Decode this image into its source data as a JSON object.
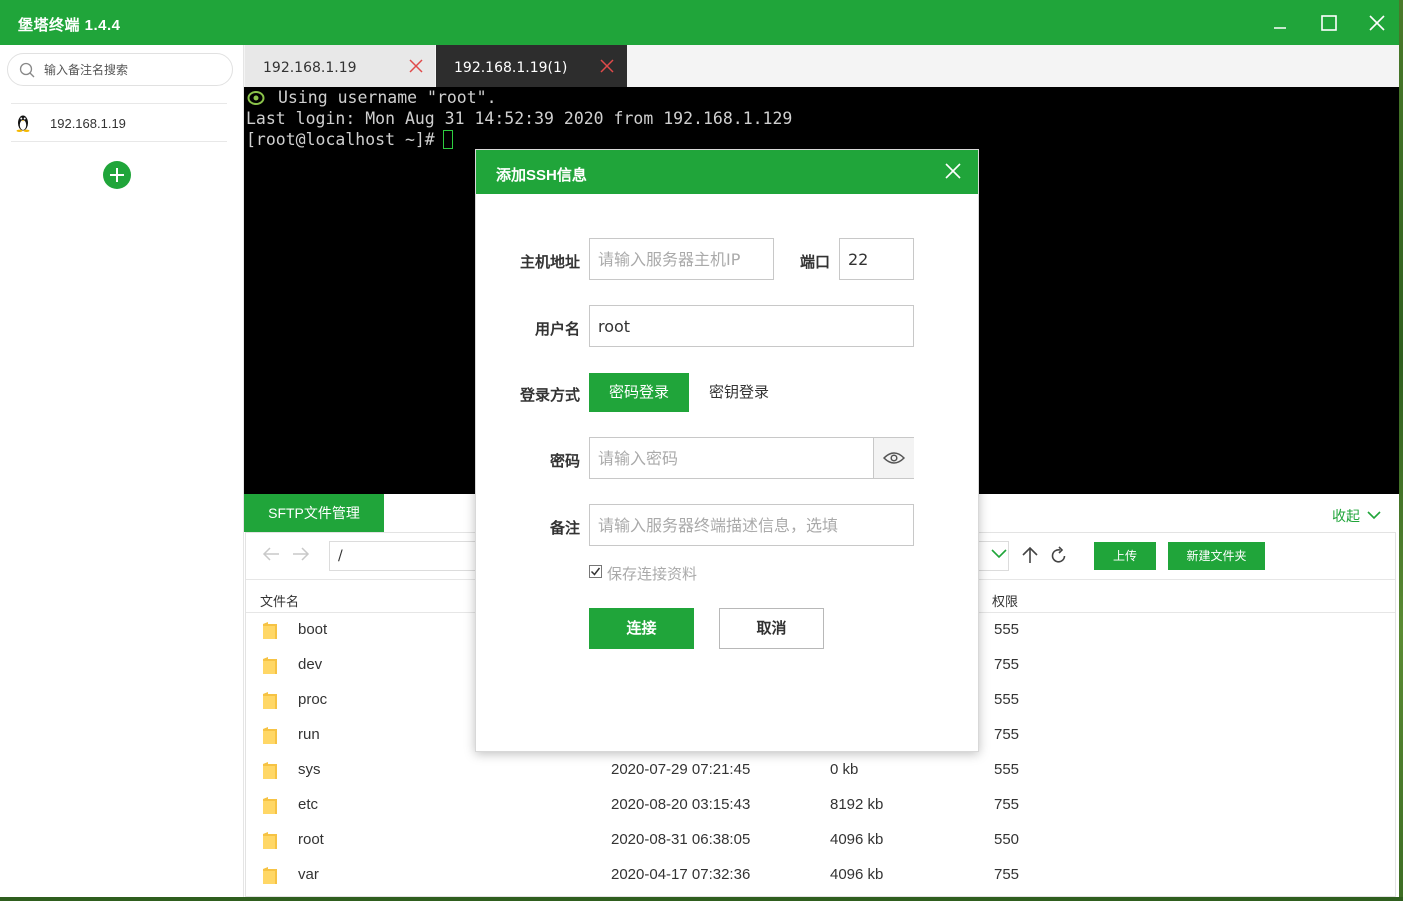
{
  "app": {
    "title": "堡塔终端 1.4.4"
  },
  "sidebar": {
    "search_placeholder": "输入备注名搜索",
    "hosts": [
      {
        "label": "192.168.1.19",
        "icon": "linux-icon"
      }
    ]
  },
  "tabs": [
    {
      "label": "192.168.1.19",
      "active": false
    },
    {
      "label": "192.168.1.19(1)",
      "active": true
    }
  ],
  "terminal": {
    "lines": [
      "Using username \"root\".",
      "Last login: Mon Aug 31 14:52:39 2020 from 192.168.1.129",
      "[root@localhost ~]#"
    ]
  },
  "sftp": {
    "tab_label": "SFTP文件管理",
    "collapse_label": "收起",
    "path": "/",
    "upload_label": "上传",
    "new_folder_label": "新建文件夹",
    "columns": {
      "name": "文件名",
      "perm": "权限"
    },
    "files": [
      {
        "name": "boot",
        "date": "",
        "size": "",
        "perm": "555"
      },
      {
        "name": "dev",
        "date": "",
        "size": "",
        "perm": "755"
      },
      {
        "name": "proc",
        "date": "",
        "size": "",
        "perm": "555"
      },
      {
        "name": "run",
        "date": "",
        "size": "",
        "perm": "755"
      },
      {
        "name": "sys",
        "date": "2020-07-29 07:21:45",
        "size": "0 kb",
        "perm": "555"
      },
      {
        "name": "etc",
        "date": "2020-08-20 03:15:43",
        "size": "8192 kb",
        "perm": "755"
      },
      {
        "name": "root",
        "date": "2020-08-31 06:38:05",
        "size": "4096 kb",
        "perm": "550"
      },
      {
        "name": "var",
        "date": "2020-04-17 07:32:36",
        "size": "4096 kb",
        "perm": "755"
      }
    ]
  },
  "dialog": {
    "title": "添加SSH信息",
    "host_label": "主机地址",
    "host_placeholder": "请输入服务器主机IP",
    "port_label": "端口",
    "port_value": "22",
    "user_label": "用户名",
    "user_value": "root",
    "login_label": "登录方式",
    "login_password": "密码登录",
    "login_key": "密钥登录",
    "password_label": "密码",
    "password_placeholder": "请输入密码",
    "note_label": "备注",
    "note_placeholder": "请输入服务器终端描述信息，选填",
    "save_label": "保存连接资料",
    "save_checked": true,
    "connect_label": "连接",
    "cancel_label": "取消"
  },
  "colors": {
    "accent": "#20a53a",
    "terminal_bg": "#000000",
    "active_tab": "#2d2d2d"
  }
}
